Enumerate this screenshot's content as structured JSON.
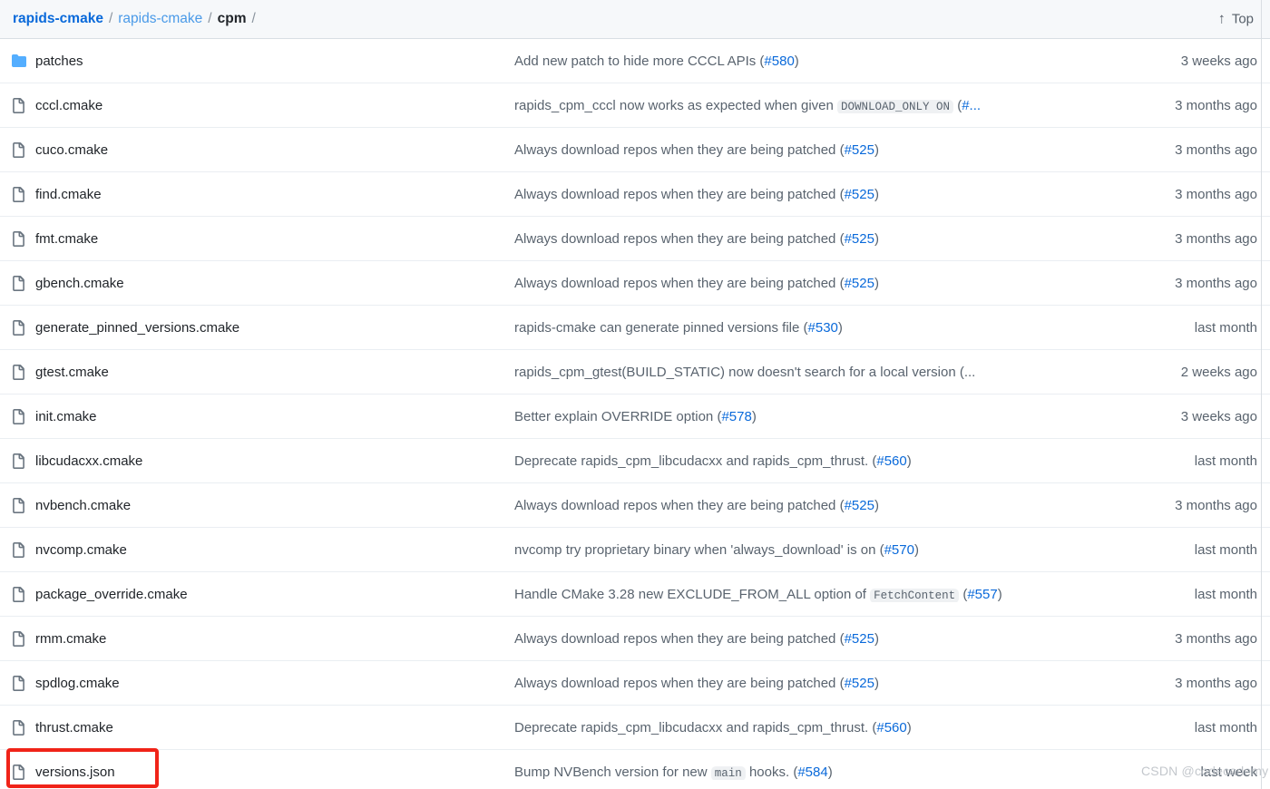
{
  "header": {
    "breadcrumb": {
      "root": "rapids-cmake",
      "repo": "rapids-cmake",
      "current": "cpm",
      "separator": "/"
    },
    "top_link": {
      "label": "Top",
      "icon": "arrow-up-icon",
      "glyph": "↑"
    }
  },
  "colors": {
    "link": "#0969da",
    "header_bg": "#f6f8fa",
    "border": "#eaeef2",
    "text": "#1f2328",
    "muted": "#59636e",
    "folder": "#54aeff",
    "annotation": "#f02318"
  },
  "rows": [
    {
      "type": "folder",
      "icon": "folder-icon",
      "name": "patches",
      "message_pre": "Add new patch to hide more CCCL APIs (",
      "message_code": "",
      "message_mid": "",
      "pr": "#580",
      "message_post": ")",
      "time": "3 weeks ago"
    },
    {
      "type": "file",
      "icon": "file-icon",
      "name": "cccl.cmake",
      "message_pre": "rapids_cpm_cccl now works as expected when given ",
      "message_code": "DOWNLOAD_ONLY ON",
      "message_mid": " (",
      "pr": "#...",
      "message_post": "",
      "time": "3 months ago"
    },
    {
      "type": "file",
      "icon": "file-icon",
      "name": "cuco.cmake",
      "message_pre": "Always download repos when they are being patched (",
      "message_code": "",
      "message_mid": "",
      "pr": "#525",
      "message_post": ")",
      "time": "3 months ago"
    },
    {
      "type": "file",
      "icon": "file-icon",
      "name": "find.cmake",
      "message_pre": "Always download repos when they are being patched (",
      "message_code": "",
      "message_mid": "",
      "pr": "#525",
      "message_post": ")",
      "time": "3 months ago"
    },
    {
      "type": "file",
      "icon": "file-icon",
      "name": "fmt.cmake",
      "message_pre": "Always download repos when they are being patched (",
      "message_code": "",
      "message_mid": "",
      "pr": "#525",
      "message_post": ")",
      "time": "3 months ago"
    },
    {
      "type": "file",
      "icon": "file-icon",
      "name": "gbench.cmake",
      "message_pre": "Always download repos when they are being patched (",
      "message_code": "",
      "message_mid": "",
      "pr": "#525",
      "message_post": ")",
      "time": "3 months ago"
    },
    {
      "type": "file",
      "icon": "file-icon",
      "name": "generate_pinned_versions.cmake",
      "message_pre": "rapids-cmake can generate pinned versions file (",
      "message_code": "",
      "message_mid": "",
      "pr": "#530",
      "message_post": ")",
      "time": "last month"
    },
    {
      "type": "file",
      "icon": "file-icon",
      "name": "gtest.cmake",
      "message_pre": "rapids_cpm_gtest(BUILD_STATIC) now doesn't search for a local version (...",
      "message_code": "",
      "message_mid": "",
      "pr": "",
      "message_post": "",
      "time": "2 weeks ago"
    },
    {
      "type": "file",
      "icon": "file-icon",
      "name": "init.cmake",
      "message_pre": "Better explain OVERRIDE option (",
      "message_code": "",
      "message_mid": "",
      "pr": "#578",
      "message_post": ")",
      "time": "3 weeks ago"
    },
    {
      "type": "file",
      "icon": "file-icon",
      "name": "libcudacxx.cmake",
      "message_pre": "Deprecate rapids_cpm_libcudacxx and rapids_cpm_thrust. (",
      "message_code": "",
      "message_mid": "",
      "pr": "#560",
      "message_post": ")",
      "time": "last month"
    },
    {
      "type": "file",
      "icon": "file-icon",
      "name": "nvbench.cmake",
      "message_pre": "Always download repos when they are being patched (",
      "message_code": "",
      "message_mid": "",
      "pr": "#525",
      "message_post": ")",
      "time": "3 months ago"
    },
    {
      "type": "file",
      "icon": "file-icon",
      "name": "nvcomp.cmake",
      "message_pre": "nvcomp try proprietary binary when 'always_download' is on (",
      "message_code": "",
      "message_mid": "",
      "pr": "#570",
      "message_post": ")",
      "time": "last month"
    },
    {
      "type": "file",
      "icon": "file-icon",
      "name": "package_override.cmake",
      "message_pre": "Handle CMake 3.28 new EXCLUDE_FROM_ALL option of ",
      "message_code": "FetchContent",
      "message_mid": " (",
      "pr": "#557",
      "message_post": ")",
      "time": "last month"
    },
    {
      "type": "file",
      "icon": "file-icon",
      "name": "rmm.cmake",
      "message_pre": "Always download repos when they are being patched (",
      "message_code": "",
      "message_mid": "",
      "pr": "#525",
      "message_post": ")",
      "time": "3 months ago"
    },
    {
      "type": "file",
      "icon": "file-icon",
      "name": "spdlog.cmake",
      "message_pre": "Always download repos when they are being patched (",
      "message_code": "",
      "message_mid": "",
      "pr": "#525",
      "message_post": ")",
      "time": "3 months ago"
    },
    {
      "type": "file",
      "icon": "file-icon",
      "name": "thrust.cmake",
      "message_pre": "Deprecate rapids_cpm_libcudacxx and rapids_cpm_thrust. (",
      "message_code": "",
      "message_mid": "",
      "pr": "#560",
      "message_post": ")",
      "time": "last month"
    },
    {
      "type": "file",
      "icon": "file-icon",
      "name": "versions.json",
      "message_pre": "Bump NVBench version for new ",
      "message_code": "main",
      "message_mid": " hooks. (",
      "pr": "#584",
      "message_post": ")",
      "time": "last week"
    }
  ],
  "annotation": {
    "target": "versions.json",
    "shape": "rectangle",
    "color": "#f02318"
  },
  "watermark": {
    "text": "CSDN @codecademy"
  }
}
